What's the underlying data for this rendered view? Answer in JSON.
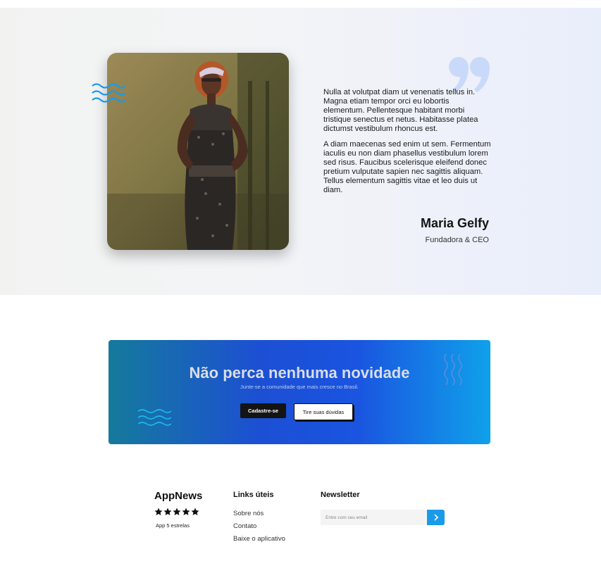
{
  "testimonial": {
    "paragraphs": [
      "Nulla at volutpat diam ut venenatis tellus in. Magna etiam tempor orci eu lobortis elementum. Pellentesque habitant morbi tristique senectus et netus. Habitasse platea dictumst vestibulum rhoncus est.",
      "A diam maecenas sed enim ut sem. Fermentum iaculis eu non diam phasellus vestibulum lorem sed risus. Faucibus scelerisque eleifend donec pretium vulputate sapien nec sagittis aliquam. Tellus elementum sagittis vitae et leo duis ut diam."
    ],
    "author_name": "Maria Gelfy",
    "author_role": "Fundadora & CEO",
    "icons": {
      "quote": "quote-icon",
      "waves": "waves-icon"
    }
  },
  "cta": {
    "title": "Não perca nenhuma novidade",
    "subtitle": "Junte-se a comunidade que mais cresce no Brasil.",
    "primary_button": "Cadastre-se",
    "secondary_button": "Tire suas dúvidas"
  },
  "footer": {
    "brand": "AppNews",
    "rating": 5,
    "rating_label": "App 5 estrelas",
    "links_title": "Links úteis",
    "links": [
      "Sobre nós",
      "Contato",
      "Baixe o aplicativo"
    ],
    "newsletter_title": "Newsletter",
    "email_placeholder": "Entre com seu email",
    "submit_icon": "chevron-right-icon"
  },
  "colors": {
    "accent": "#1a9be8",
    "cta_gradient_start": "#157a9c",
    "cta_gradient_mid": "#1c4fd4",
    "cta_gradient_end": "#10a1ea",
    "dark_button": "#141414"
  }
}
